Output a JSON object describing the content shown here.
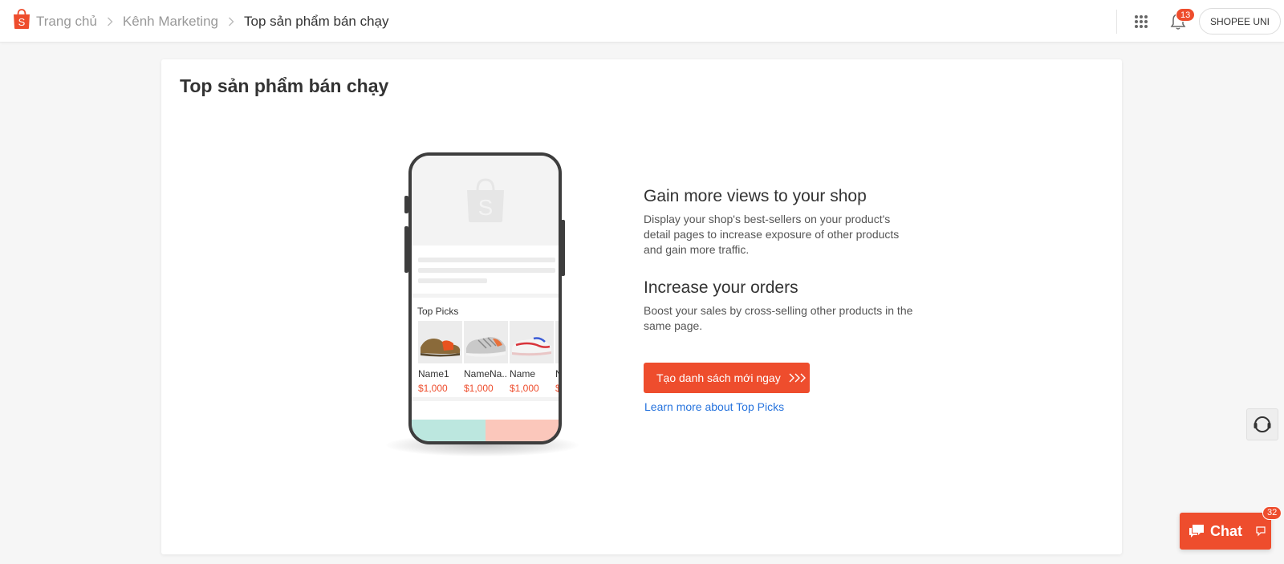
{
  "colors": {
    "accent": "#ee4d2d",
    "link": "#2673dd"
  },
  "header": {
    "breadcrumbs": [
      {
        "label": "Trang chủ"
      },
      {
        "label": "Kênh Marketing"
      },
      {
        "label": "Top sản phẩm bán chạy"
      }
    ],
    "icons": [
      "shopee-logo",
      "apps-grid-icon",
      "bell-icon"
    ],
    "notification_count": "13",
    "shop_name": "SHOPEE UNI"
  },
  "main": {
    "title": "Top sản phẩm bán chạy",
    "phone_mock": {
      "section_label": "Top Picks",
      "products": [
        {
          "name": "Name1",
          "price": "$1,000"
        },
        {
          "name": "NameNa...",
          "price": "$1,000"
        },
        {
          "name": "Name",
          "price": "$1,000"
        },
        {
          "name": "N",
          "price": "$"
        }
      ]
    },
    "features": [
      {
        "title": "Gain more views to your shop",
        "description": "Display your shop's best-sellers on your product's detail pages to increase exposure of other products and gain more traffic."
      },
      {
        "title": "Increase your orders",
        "description": "Boost your sales by cross-selling other products in the same page."
      }
    ],
    "cta_label": "Tạo danh sách mới ngay",
    "learn_more_label": "Learn more about Top Picks"
  },
  "widgets": {
    "chat_label": "Chat",
    "chat_badge": "32"
  }
}
